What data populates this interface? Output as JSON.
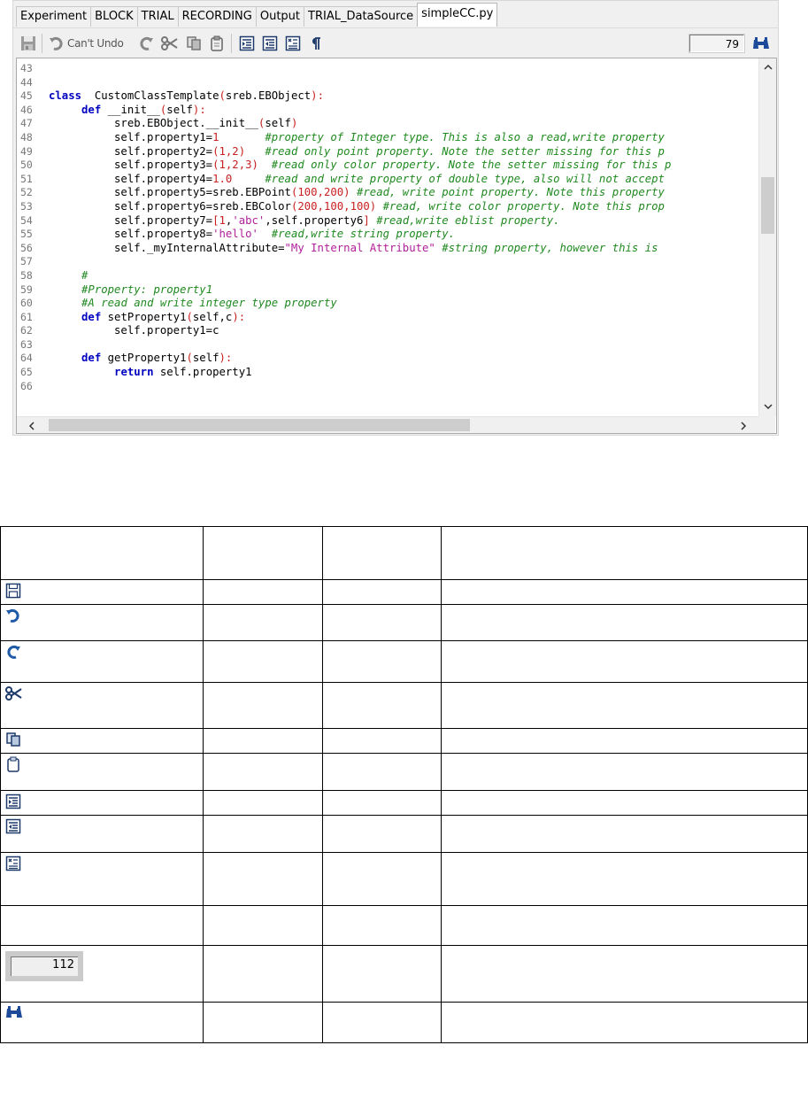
{
  "tabs": [
    {
      "label": "Experiment",
      "active": false
    },
    {
      "label": "BLOCK",
      "active": false
    },
    {
      "label": "TRIAL",
      "active": false
    },
    {
      "label": "RECORDING",
      "active": false
    },
    {
      "label": "Output",
      "active": false
    },
    {
      "label": "TRIAL_DataSource",
      "active": false
    },
    {
      "label": "simpleCC.py",
      "active": true
    }
  ],
  "toolbar": {
    "undo_label": "Can't Undo",
    "line_number": "79",
    "icons": [
      "save-icon",
      "undo-icon",
      "redo-icon",
      "cut-icon",
      "copy-icon",
      "paste-icon",
      "indent-icon",
      "outdent-icon",
      "comment-icon",
      "whitespace-icon",
      "find-icon"
    ]
  },
  "code": {
    "line_numbers": [
      "43",
      "44",
      "45",
      "46",
      "47",
      "48",
      "49",
      "50",
      "51",
      "52",
      "53",
      "54",
      "55",
      "56",
      "57",
      "58",
      "59",
      "60",
      "61",
      "62",
      "63",
      "64",
      "65",
      "66"
    ],
    "lines": [
      [],
      [],
      [
        [
          "kw",
          "class"
        ],
        [
          "",
          "  CustomClassTemplate"
        ],
        [
          "pn",
          "("
        ],
        [
          "",
          "sreb.EBObject"
        ],
        [
          "pn",
          "):"
        ]
      ],
      [
        [
          "",
          "     "
        ],
        [
          "kw",
          "def"
        ],
        [
          "",
          " __init__"
        ],
        [
          "pn",
          "("
        ],
        [
          "",
          "self"
        ],
        [
          "pn",
          "):"
        ]
      ],
      [
        [
          "",
          "          sreb.EBObject.__init__"
        ],
        [
          "pn",
          "("
        ],
        [
          "",
          "self"
        ],
        [
          "pn",
          ")"
        ]
      ],
      [
        [
          "",
          "          self.property1="
        ],
        [
          "nm",
          "1"
        ],
        [
          "",
          "       "
        ],
        [
          "cm",
          "#property of Integer type. This is also a read,write property"
        ]
      ],
      [
        [
          "",
          "          self.property2="
        ],
        [
          "pn",
          "("
        ],
        [
          "nm",
          "1,2"
        ],
        [
          "pn",
          ")"
        ],
        [
          "",
          "   "
        ],
        [
          "cm",
          "#read only point property. Note the setter missing for this p"
        ]
      ],
      [
        [
          "",
          "          self.property3="
        ],
        [
          "pn",
          "("
        ],
        [
          "nm",
          "1,2,3"
        ],
        [
          "pn",
          ")"
        ],
        [
          "",
          "  "
        ],
        [
          "cm",
          "#read only color property. Note the setter missing for this p"
        ]
      ],
      [
        [
          "",
          "          self.property4="
        ],
        [
          "nm",
          "1.0"
        ],
        [
          "",
          "     "
        ],
        [
          "cm",
          "#read and write property of double type, also will not accept"
        ]
      ],
      [
        [
          "",
          "          self.property5=sreb.EBPoint"
        ],
        [
          "pn",
          "("
        ],
        [
          "nm",
          "100,200"
        ],
        [
          "pn",
          ")"
        ],
        [
          "",
          " "
        ],
        [
          "cm",
          "#read, write point property. Note this property"
        ]
      ],
      [
        [
          "",
          "          self.property6=sreb.EBColor"
        ],
        [
          "pn",
          "("
        ],
        [
          "nm",
          "200,100,100"
        ],
        [
          "pn",
          ")"
        ],
        [
          "",
          " "
        ],
        [
          "cm",
          "#read, write color property. Note this prop"
        ]
      ],
      [
        [
          "",
          "          self.property7="
        ],
        [
          "pn",
          "["
        ],
        [
          "nm",
          "1"
        ],
        [
          "",
          ","
        ],
        [
          "st",
          "'abc'"
        ],
        [
          "",
          ",self.property6"
        ],
        [
          "pn",
          "]"
        ],
        [
          "",
          " "
        ],
        [
          "cm",
          "#read,write eblist property."
        ]
      ],
      [
        [
          "",
          "          self.property8="
        ],
        [
          "st",
          "'hello'"
        ],
        [
          "",
          "  "
        ],
        [
          "cm",
          "#read,write string property."
        ]
      ],
      [
        [
          "",
          "          self._myInternalAttribute="
        ],
        [
          "st",
          "\"My Internal Attribute\""
        ],
        [
          "",
          " "
        ],
        [
          "cm",
          "#string property, however this is"
        ]
      ],
      [],
      [
        [
          "",
          "     "
        ],
        [
          "cm",
          "#"
        ]
      ],
      [
        [
          "",
          "     "
        ],
        [
          "cm",
          "#Property: property1"
        ]
      ],
      [
        [
          "",
          "     "
        ],
        [
          "cm",
          "#A read and write integer type property"
        ]
      ],
      [
        [
          "",
          "     "
        ],
        [
          "kw",
          "def"
        ],
        [
          "",
          " setProperty1"
        ],
        [
          "pn",
          "("
        ],
        [
          "",
          "self,c"
        ],
        [
          "pn",
          "):"
        ]
      ],
      [
        [
          "",
          "          self.property1=c"
        ]
      ],
      [],
      [
        [
          "",
          "     "
        ],
        [
          "kw",
          "def"
        ],
        [
          "",
          " getProperty1"
        ],
        [
          "pn",
          "("
        ],
        [
          "",
          "self"
        ],
        [
          "pn",
          "):"
        ]
      ],
      [
        [
          "",
          "          "
        ],
        [
          "kw",
          "return"
        ],
        [
          "",
          " self.property1"
        ]
      ],
      []
    ]
  },
  "reference_table": {
    "rows": [
      {
        "icon": "",
        "c1": "",
        "c2": "",
        "c3": ""
      },
      {
        "icon": "save-icon",
        "c1": "",
        "c2": "",
        "c3": ""
      },
      {
        "icon": "undo-icon",
        "c1": "",
        "c2": "",
        "c3": ""
      },
      {
        "icon": "redo-icon",
        "c1": "",
        "c2": "",
        "c3": ""
      },
      {
        "icon": "cut-icon",
        "c1": "",
        "c2": "",
        "c3": ""
      },
      {
        "icon": "copy-icon",
        "c1": "",
        "c2": "",
        "c3": ""
      },
      {
        "icon": "paste-icon",
        "c1": "",
        "c2": "",
        "c3": ""
      },
      {
        "icon": "indent-icon",
        "c1": "",
        "c2": "",
        "c3": ""
      },
      {
        "icon": "outdent-icon",
        "c1": "",
        "c2": "",
        "c3": ""
      },
      {
        "icon": "comment-icon",
        "c1": "",
        "c2": "",
        "c3": ""
      },
      {
        "icon": "",
        "c1": "",
        "c2": "",
        "c3": ""
      },
      {
        "icon": "line-number-box",
        "value": "112",
        "c1": "",
        "c2": "",
        "c3": ""
      },
      {
        "icon": "find-icon",
        "c1": "",
        "c2": "",
        "c3": ""
      }
    ]
  },
  "colors": {
    "keyword": "#0000c0",
    "comment": "#208a20",
    "string": "#b0209a",
    "number": "#c82020",
    "icon_blue": "#1e5aa8"
  }
}
